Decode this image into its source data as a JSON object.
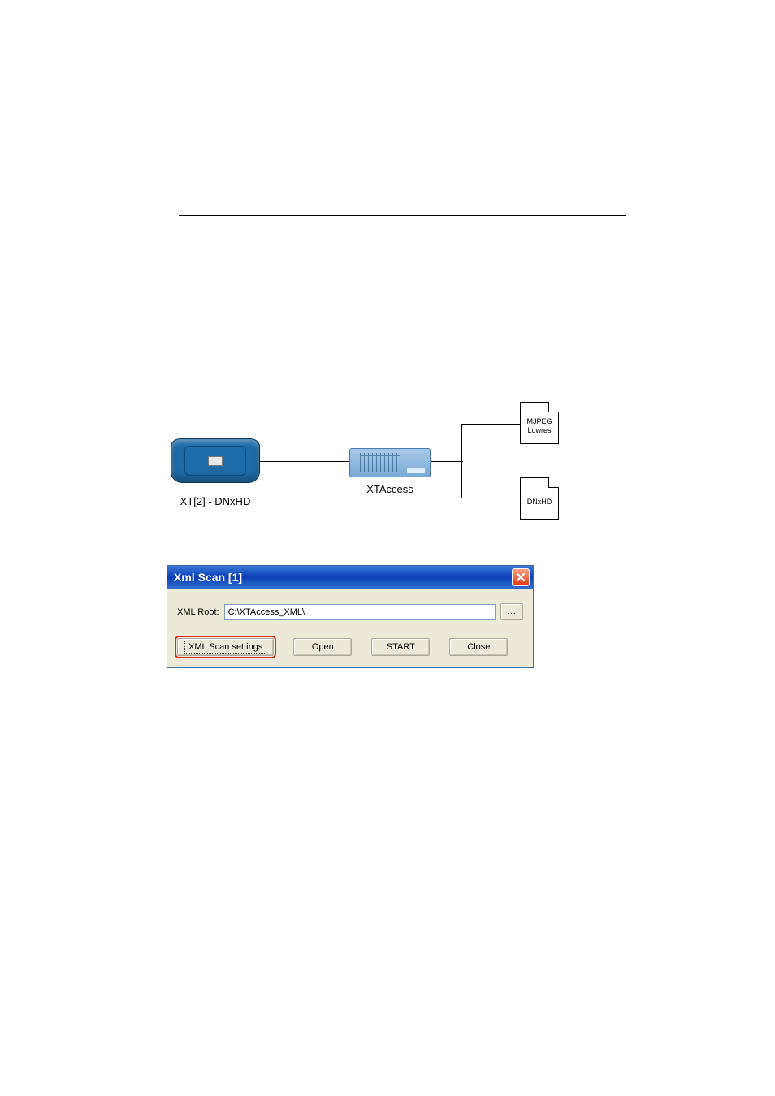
{
  "diagram": {
    "xt2_label": "XT[2] - DNxHD",
    "xtaccess_label": "XTAccess",
    "doc_mjpeg_line1": "MJPEG",
    "doc_mjpeg_line2": "Lowres",
    "doc_dnxhd": "DNxHD"
  },
  "dialog": {
    "title": "Xml Scan [1]",
    "xml_root_label": "XML Root:",
    "xml_root_value": "C:\\XTAccess_XML\\",
    "browse_btn": "...",
    "buttons": {
      "settings": "XML Scan settings",
      "open": "Open",
      "start": "START",
      "close": "Close"
    }
  }
}
